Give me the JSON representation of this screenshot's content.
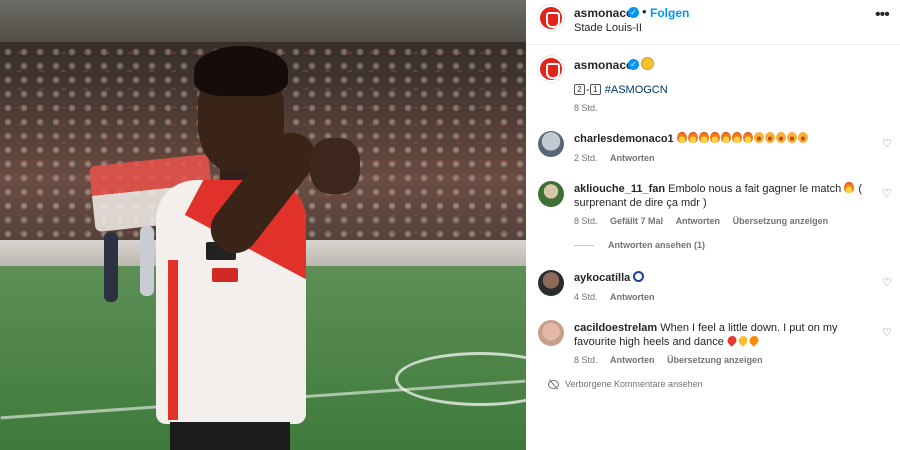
{
  "post": {
    "account": "asmonaco",
    "follow_label": "Folgen",
    "location": "Stade Louis-II",
    "more_icon": "more-horizontal-icon"
  },
  "caption": {
    "account": "asmonaco",
    "score_home": "2",
    "score_away": "1",
    "hashtag": "#ASMOGCN",
    "time": "8 Std."
  },
  "comments": [
    {
      "user": "charlesdemonaco1",
      "text": "",
      "time": "2 Std.",
      "reply_label": "Antworten"
    },
    {
      "user": "akliouche_11_fan",
      "text": "Embolo nous a fait gagner le match",
      "text_cont": "( surprenant de dire ça mdr )",
      "time": "8 Std.",
      "likes": "Gefällt 7 Mal",
      "reply_label": "Antworten",
      "translate_label": "Übersetzung anzeigen",
      "view_replies": "Antworten ansehen (1)"
    },
    {
      "user": "aykocatilla",
      "text": "",
      "time": "4 Std.",
      "reply_label": "Antworten"
    },
    {
      "user": "cacildoestrelam",
      "text": "When I feel a little down. I put on my favourite high heels and dance",
      "time": "8 Std.",
      "reply_label": "Antworten",
      "translate_label": "Übersetzung anzeigen"
    }
  ],
  "hidden_comments_label": "Verborgene Kommentare ansehen",
  "colors": {
    "link_blue": "#0095f6",
    "hashtag": "#00376b",
    "muted": "#737373",
    "club_red": "#e2231a"
  }
}
